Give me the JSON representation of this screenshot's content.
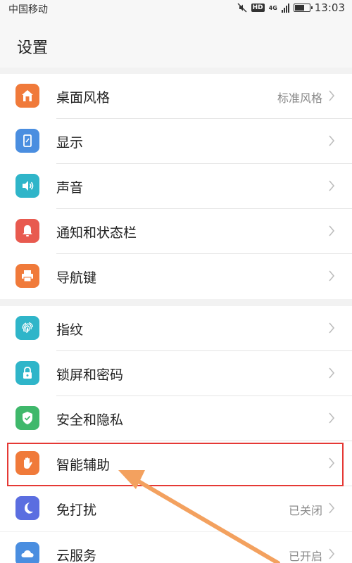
{
  "status_bar": {
    "carrier": "中国移动",
    "hd": "HD",
    "network": "4G",
    "time": "13:03",
    "battery_level": 0.7
  },
  "header": {
    "title": "设置"
  },
  "groups": [
    {
      "items": [
        {
          "label": "桌面风格",
          "value": "标准风格",
          "icon": "home-icon",
          "color": "#f07a3a"
        },
        {
          "label": "显示",
          "value": "",
          "icon": "phone-display-icon",
          "color": "#4a8ee0"
        },
        {
          "label": "声音",
          "value": "",
          "icon": "speaker-icon",
          "color": "#2fb5c9"
        },
        {
          "label": "通知和状态栏",
          "value": "",
          "icon": "bell-icon",
          "color": "#e85a4f"
        },
        {
          "label": "导航键",
          "value": "",
          "icon": "printer-icon",
          "color": "#f07a3a"
        }
      ]
    },
    {
      "items": [
        {
          "label": "指纹",
          "value": "",
          "icon": "fingerprint-icon",
          "color": "#2fb5c9"
        },
        {
          "label": "锁屏和密码",
          "value": "",
          "icon": "lock-icon",
          "color": "#2fb5c9"
        },
        {
          "label": "安全和隐私",
          "value": "",
          "icon": "shield-check-icon",
          "color": "#3fb86b"
        },
        {
          "label": "智能辅助",
          "value": "",
          "icon": "hand-icon",
          "color": "#f07a3a"
        },
        {
          "label": "免打扰",
          "value": "已关闭",
          "icon": "moon-icon",
          "color": "#5b6ee0"
        }
      ]
    },
    {
      "items": [
        {
          "label": "云服务",
          "value": "已开启",
          "icon": "cloud-icon",
          "color": "#4a8ee0"
        }
      ]
    }
  ]
}
